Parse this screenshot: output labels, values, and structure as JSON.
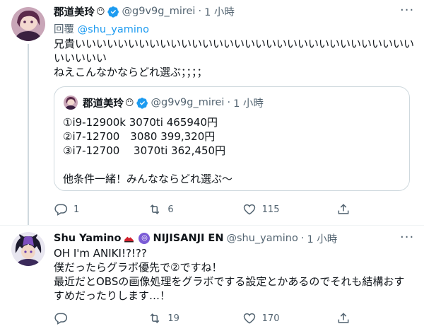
{
  "colors": {
    "accent": "#1d9bf0",
    "text": "#0f1419",
    "muted": "#536471",
    "border": "#cfd9de"
  },
  "tweet1": {
    "display_name": "郡道美玲",
    "name_emoji": "😶",
    "handle": "@g9v9g_mirei",
    "time": "1 小時",
    "reply_prefix": "回覆",
    "reply_to": "@shu_yamino",
    "text_lines": [
      "兄貴いいいいいいいいいいいいいいいいいいいいいいいいいいいいいいいい",
      "いいいいい",
      "ねえこんなかならどれ選ぶ；；；；"
    ],
    "quote": {
      "display_name": "郡道美玲",
      "name_emoji": "😶",
      "handle": "@g9v9g_mirei",
      "time": "1 小時",
      "lines": [
        "①i9-12900k 3070ti 465940円",
        "②i7-12700　3080 399,320円",
        "③i7-12700　 3070ti 362,450円",
        "",
        "他条件一緒！みんなならどれ選ぶ～"
      ]
    },
    "actions": {
      "reply_count": "1",
      "retweet_count": "6",
      "like_count": "115",
      "share_icon": "share-icon"
    }
  },
  "tweet2": {
    "display_name": "Shu Yamino",
    "affiliation": "NIJISANJI EN",
    "handle": "@shu_yamino",
    "time": "1 小時",
    "text_lines": [
      "OH I'm ANIKI!?!??",
      "僕だったらグラボ優先で②ですね！",
      "最近だとOBSの画像処理をグラボでする設定とかあるのでそれも結構おす",
      "すめだったりします…！"
    ],
    "actions": {
      "reply_count": "",
      "retweet_count": "19",
      "like_count": "170",
      "share_icon": "share-icon"
    }
  }
}
